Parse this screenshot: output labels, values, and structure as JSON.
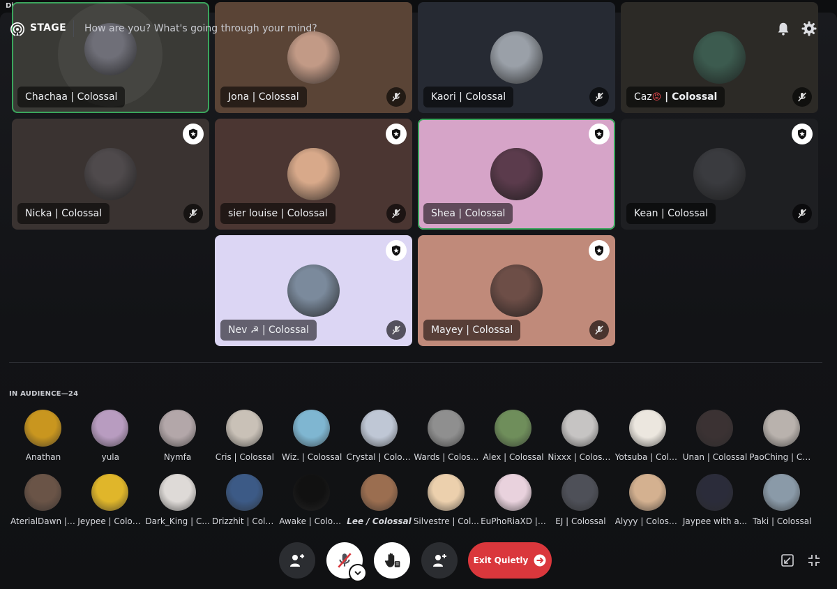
{
  "app": {
    "title": "Discord"
  },
  "header": {
    "label": "STAGE",
    "topic": "How are you? What's going through your mind?"
  },
  "speakers": [
    {
      "name": "Chachaa | Colossal",
      "bg": "#3a3a36",
      "avatar": "#6f6f78",
      "speaking": true,
      "mod": false,
      "muted": false
    },
    {
      "name": "Jona | Colossal",
      "bg": "#5a4436",
      "avatar": "#c29a86",
      "speaking": false,
      "mod": false,
      "muted": true
    },
    {
      "name": "Kaori | Colossal",
      "bg": "#262a33",
      "avatar": "#9aa0a8",
      "speaking": false,
      "mod": false,
      "muted": true
    },
    {
      "name": "Caz",
      "emoji": "😡",
      "name_suffix": " | Colossal",
      "bg": "#2c2a26",
      "avatar": "#3c5b4f",
      "speaking": false,
      "mod": false,
      "muted": true
    },
    {
      "name": "Nicka | Colossal",
      "bg": "#3a3331",
      "avatar": "#4f4a4c",
      "speaking": false,
      "mod": true,
      "muted": true
    },
    {
      "name": "sier louise | Colossal",
      "bg": "#4b3632",
      "avatar": "#d8a98a",
      "speaking": false,
      "mod": true,
      "muted": true
    },
    {
      "name": "Shea | Colossal",
      "bg": "#d6a4c8",
      "avatar": "#5b3b4c",
      "speaking": true,
      "mod": true,
      "muted": false
    },
    {
      "name": "Kean | Colossal",
      "bg": "#1e1f22",
      "avatar": "#3a3b3f",
      "speaking": false,
      "mod": true,
      "muted": true
    },
    {
      "name": "Nev ☭ | Colossal",
      "bg": "#dcd6f4",
      "avatar": "#7b8a9c",
      "speaking": false,
      "mod": true,
      "muted": true
    },
    {
      "name": "Mayey | Colossal",
      "bg": "#c08a7a",
      "avatar": "#6d4e47",
      "speaking": false,
      "mod": true,
      "muted": true
    }
  ],
  "audience": {
    "title": "IN AUDIENCE—24",
    "members": [
      {
        "name": "Anathan",
        "color": "#c9961f"
      },
      {
        "name": "yula",
        "color": "#b89cc0"
      },
      {
        "name": "Nymfa",
        "color": "#b3a7a9"
      },
      {
        "name": "Cris | Colossal",
        "color": "#c9c1b7"
      },
      {
        "name": "Wiz. | Colossal",
        "color": "#7fb6d1"
      },
      {
        "name": "Crystal | Colos...",
        "color": "#bfc7d5"
      },
      {
        "name": "Wards | Colos...",
        "color": "#8f8f8f"
      },
      {
        "name": "Alex | Colossal",
        "color": "#6f8e5b"
      },
      {
        "name": "Nixxx | Colossal",
        "color": "#c6c4c3"
      },
      {
        "name": "Yotsuba | Colo...",
        "color": "#ece7df"
      },
      {
        "name": "Unan | Colossal",
        "color": "#3b3233"
      },
      {
        "name": "PaoChing | Co...",
        "color": "#b9b2ad"
      },
      {
        "name": "AterialDawn | ...",
        "color": "#6a5447"
      },
      {
        "name": "Jeypee | Colos...",
        "color": "#e0b62a"
      },
      {
        "name": "Dark_King | C...",
        "color": "#dedad7"
      },
      {
        "name": "Drizzhit | Colo...",
        "color": "#3c5a86"
      },
      {
        "name": "Awake | Colos...",
        "color": "#111111"
      },
      {
        "name": "Lee / Colossal",
        "color": "#9b6e50",
        "italic": true
      },
      {
        "name": "Silvestre | Col...",
        "color": "#ecd0ad"
      },
      {
        "name": "EuPhoRiaXD | ...",
        "color": "#e9d2dd"
      },
      {
        "name": "EJ | Colossal",
        "color": "#4e5058"
      },
      {
        "name": "Alyyy | Colossal",
        "color": "#d4b190"
      },
      {
        "name": "Jaypee with a...",
        "color": "#2b2c3a"
      },
      {
        "name": "Taki | Colossal",
        "color": "#8a9aa8"
      }
    ]
  },
  "controls": {
    "exit_label": "Exit Quietly"
  }
}
